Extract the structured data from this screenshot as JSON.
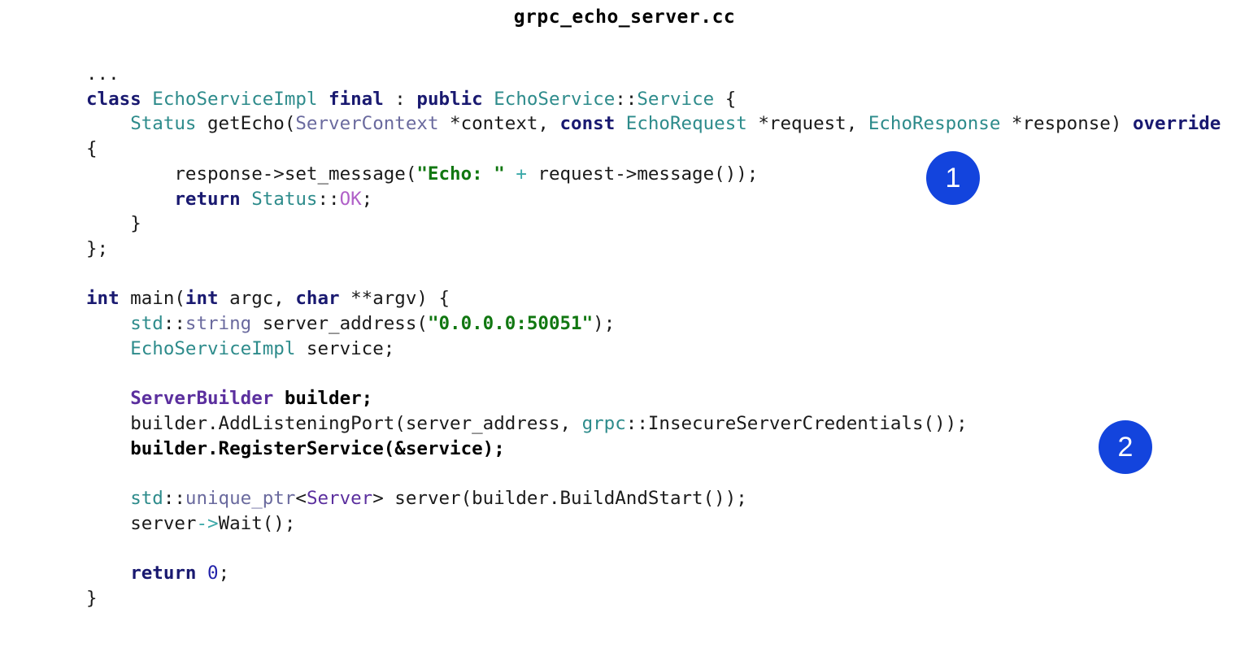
{
  "title": "grpc_echo_server.cc",
  "code": {
    "language": "cpp",
    "lines": [
      {
        "id": "line-ellipsis",
        "tokens": [
          {
            "t": "...",
            "c": "plain"
          }
        ]
      },
      {
        "id": "line-class-decl",
        "tokens": [
          {
            "t": "class",
            "c": "kw"
          },
          {
            "t": " ",
            "c": "plain"
          },
          {
            "t": "EchoServiceImpl",
            "c": "type"
          },
          {
            "t": " ",
            "c": "plain"
          },
          {
            "t": "final",
            "c": "kw"
          },
          {
            "t": " : ",
            "c": "plain"
          },
          {
            "t": "public",
            "c": "kw"
          },
          {
            "t": " ",
            "c": "plain"
          },
          {
            "t": "EchoService",
            "c": "type"
          },
          {
            "t": "::",
            "c": "plain"
          },
          {
            "t": "Service",
            "c": "type"
          },
          {
            "t": " {",
            "c": "plain"
          }
        ]
      },
      {
        "id": "line-getecho-sig",
        "tokens": [
          {
            "t": "    ",
            "c": "plain"
          },
          {
            "t": "Status",
            "c": "type"
          },
          {
            "t": " getEcho(",
            "c": "plain"
          },
          {
            "t": "ServerContext",
            "c": "ident"
          },
          {
            "t": " *context, ",
            "c": "plain"
          },
          {
            "t": "const",
            "c": "kw"
          },
          {
            "t": " ",
            "c": "plain"
          },
          {
            "t": "EchoRequest",
            "c": "type"
          },
          {
            "t": " *request, ",
            "c": "plain"
          },
          {
            "t": "EchoResponse",
            "c": "type"
          },
          {
            "t": " *response) ",
            "c": "plain"
          },
          {
            "t": "override",
            "c": "kw"
          },
          {
            "t": " {",
            "c": "plain"
          }
        ]
      },
      {
        "id": "line-set-message",
        "tokens": [
          {
            "t": "        response->set_message(",
            "c": "plain"
          },
          {
            "t": "\"Echo: \"",
            "c": "str"
          },
          {
            "t": " ",
            "c": "plain"
          },
          {
            "t": "+",
            "c": "op"
          },
          {
            "t": " request->message());",
            "c": "plain"
          }
        ]
      },
      {
        "id": "line-return-status",
        "tokens": [
          {
            "t": "        ",
            "c": "plain"
          },
          {
            "t": "return",
            "c": "kw"
          },
          {
            "t": " ",
            "c": "plain"
          },
          {
            "t": "Status",
            "c": "type"
          },
          {
            "t": "::",
            "c": "plain"
          },
          {
            "t": "OK",
            "c": "const"
          },
          {
            "t": ";",
            "c": "plain"
          }
        ]
      },
      {
        "id": "line-close-method",
        "tokens": [
          {
            "t": "    }",
            "c": "plain"
          }
        ]
      },
      {
        "id": "line-close-class",
        "tokens": [
          {
            "t": "};",
            "c": "plain"
          }
        ]
      },
      {
        "id": "line-blank-1",
        "tokens": []
      },
      {
        "id": "line-main-sig",
        "tokens": [
          {
            "t": "int",
            "c": "kw"
          },
          {
            "t": " main(",
            "c": "plain"
          },
          {
            "t": "int",
            "c": "kw"
          },
          {
            "t": " argc, ",
            "c": "plain"
          },
          {
            "t": "char",
            "c": "kw"
          },
          {
            "t": " **argv) {",
            "c": "plain"
          }
        ]
      },
      {
        "id": "line-server-address",
        "tokens": [
          {
            "t": "    ",
            "c": "plain"
          },
          {
            "t": "std",
            "c": "ns"
          },
          {
            "t": "::",
            "c": "plain"
          },
          {
            "t": "string",
            "c": "ident"
          },
          {
            "t": " server_address(",
            "c": "plain"
          },
          {
            "t": "\"0.0.0.0:50051\"",
            "c": "str"
          },
          {
            "t": ");",
            "c": "plain"
          }
        ]
      },
      {
        "id": "line-service-inst",
        "tokens": [
          {
            "t": "    ",
            "c": "plain"
          },
          {
            "t": "EchoServiceImpl",
            "c": "type"
          },
          {
            "t": " service;",
            "c": "plain"
          }
        ]
      },
      {
        "id": "line-blank-2",
        "tokens": []
      },
      {
        "id": "line-builder-decl",
        "tokens": [
          {
            "t": "    ",
            "c": "plain"
          },
          {
            "t": "ServerBuilder",
            "c": "class"
          },
          {
            "t": " ",
            "c": "plain"
          },
          {
            "t": "builder;",
            "c": "bold"
          }
        ]
      },
      {
        "id": "line-add-listening-port",
        "tokens": [
          {
            "t": "    builder.AddListeningPort(server_address, ",
            "c": "plain"
          },
          {
            "t": "grpc",
            "c": "ns"
          },
          {
            "t": "::InsecureServerCredentials());",
            "c": "plain"
          }
        ]
      },
      {
        "id": "line-register-service",
        "tokens": [
          {
            "t": "    ",
            "c": "plain"
          },
          {
            "t": "builder.RegisterService(&service);",
            "c": "bold"
          }
        ]
      },
      {
        "id": "line-blank-3",
        "tokens": []
      },
      {
        "id": "line-unique-ptr-server",
        "tokens": [
          {
            "t": "    ",
            "c": "plain"
          },
          {
            "t": "std",
            "c": "ns"
          },
          {
            "t": "::",
            "c": "plain"
          },
          {
            "t": "unique_ptr",
            "c": "ident"
          },
          {
            "t": "<",
            "c": "plain"
          },
          {
            "t": "Server",
            "c": "class-plain"
          },
          {
            "t": "> server(builder.BuildAndStart());",
            "c": "plain"
          }
        ]
      },
      {
        "id": "line-server-wait",
        "tokens": [
          {
            "t": "    server",
            "c": "plain"
          },
          {
            "t": "->",
            "c": "op"
          },
          {
            "t": "Wait();",
            "c": "plain"
          }
        ]
      },
      {
        "id": "line-blank-4",
        "tokens": []
      },
      {
        "id": "line-return-zero",
        "tokens": [
          {
            "t": "    ",
            "c": "plain"
          },
          {
            "t": "return",
            "c": "kw"
          },
          {
            "t": " ",
            "c": "plain"
          },
          {
            "t": "0",
            "c": "num"
          },
          {
            "t": ";",
            "c": "plain"
          }
        ]
      },
      {
        "id": "line-close-main",
        "tokens": [
          {
            "t": "}",
            "c": "plain"
          }
        ]
      }
    ]
  },
  "badges": [
    {
      "id": "step-badge-1",
      "label": "1"
    },
    {
      "id": "step-badge-2",
      "label": "2"
    }
  ],
  "colors": {
    "badge_blue": "#1344dd",
    "keyword": "#191970",
    "type_teal": "#2d8b8b",
    "identifier_purple": "#6a6a9e",
    "class_violet": "#5b2f9e",
    "string_green": "#117711",
    "operator_cyan": "#3aa8a8",
    "constant_orchid": "#b060c8",
    "number_blue": "#2222aa",
    "text_black": "#1a1a1a",
    "background": "#ffffff"
  }
}
